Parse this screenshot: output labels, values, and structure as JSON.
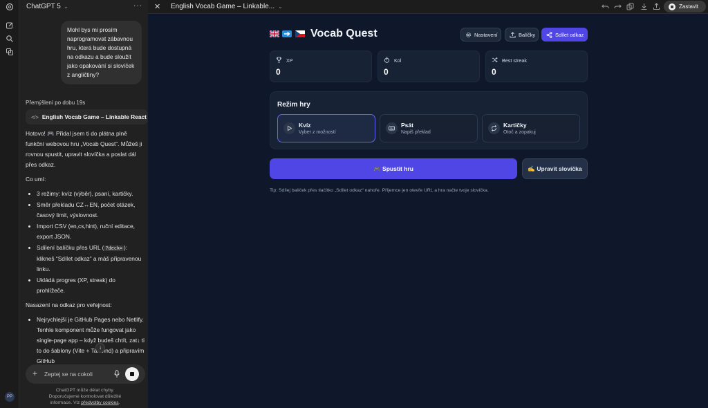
{
  "chat": {
    "title": "ChatGPT 5",
    "more_label": "···",
    "user_message": "Mohl bys mi prosím naprogramovat zábavnou hru, která bude dostupná na odkazu a bude sloužit jako opakování si slovíček z angličtiny?",
    "thought_label": "Přemýšlení po dobu 19s",
    "canvas_chip_label": "English Vocab Game – Linkable React",
    "reply_intro": "Hotovo! 🎮 Přidal jsem ti do plátna plně funkční webovou hru „Vocab Quest“. Můžeš ji rovnou spustit, upravit slovíčka a poslat dál přes odkaz.",
    "features_heading": "Co umí:",
    "features": [
      "3 režimy: kvíz (výběr), psaní, kartičky.",
      "Směr překladu CZ↔EN, počet otázek, časový limit, výslovnost.",
      "Import CSV (en,cs,hint), ruční editace, export JSON."
    ],
    "share_feature": {
      "prefix": "Sdílení balíčku přes URL (",
      "code": "?deck=",
      "suffix": "): klikneš “Sdílet odkaz” a máš připravenou linku."
    },
    "progress_feature": "Ukládá progres (XP, streak) do prohlížeče.",
    "deploy_heading": "Nasazení na odkaz pro veřejnost:",
    "deploy_item": "Nejrychlejší je GitHub Pages nebo Netlify. Tenhle komponent může fungovat jako single-page app – když budeš chtít, zat↓ ti to do šablony (Vite + Tailwind) a připravím GitHub",
    "composer_placeholder": "Zeptej se na cokoli",
    "disclaimer_line1": "ChatGPT může dělat chyby.",
    "disclaimer_line2": "Doporučujeme kontrolovat důležité",
    "disclaimer_prefix": "informace. Viz ",
    "disclaimer_link": "předvolby cookies",
    "disclaimer_suffix": ".",
    "avatar_initials": "PP"
  },
  "canvas": {
    "title": "English Vocab Game – Linkable...",
    "stop_label": "Zastavit"
  },
  "app": {
    "title": "Vocab Quest",
    "buttons": {
      "settings": "Nastavení",
      "decks": "Balíčky",
      "share": "Sdílet odkaz"
    },
    "stats": [
      {
        "label": "XP",
        "value": "0",
        "icon": "trophy-icon"
      },
      {
        "label": "Kol",
        "value": "0",
        "icon": "timer-icon"
      },
      {
        "label": "Best streak",
        "value": "0",
        "icon": "shuffle-icon"
      }
    ],
    "mode_heading": "Režim hry",
    "modes": [
      {
        "title": "Kvíz",
        "desc": "Vyber z možností",
        "icon": "play-icon"
      },
      {
        "title": "Psát",
        "desc": "Napiš překlad",
        "icon": "keyboard-icon"
      },
      {
        "title": "Kartičky",
        "desc": "Otoč a zopakuj",
        "icon": "flip-icon"
      }
    ],
    "start_label": "🎮 Spustit hru",
    "edit_label": "✍️ Upravit slovíčka",
    "tip": "Tip: Sdílej balíček přes tlačítko „Sdílet odkaz“ nahoře. Příjemce jen otevře URL a hra načte tvoje slovíčka."
  },
  "colors": {
    "app_bg": "#0f172a",
    "card_bg": "#182235",
    "accent": "#4f46e5",
    "sidebar_bg": "#212121"
  }
}
